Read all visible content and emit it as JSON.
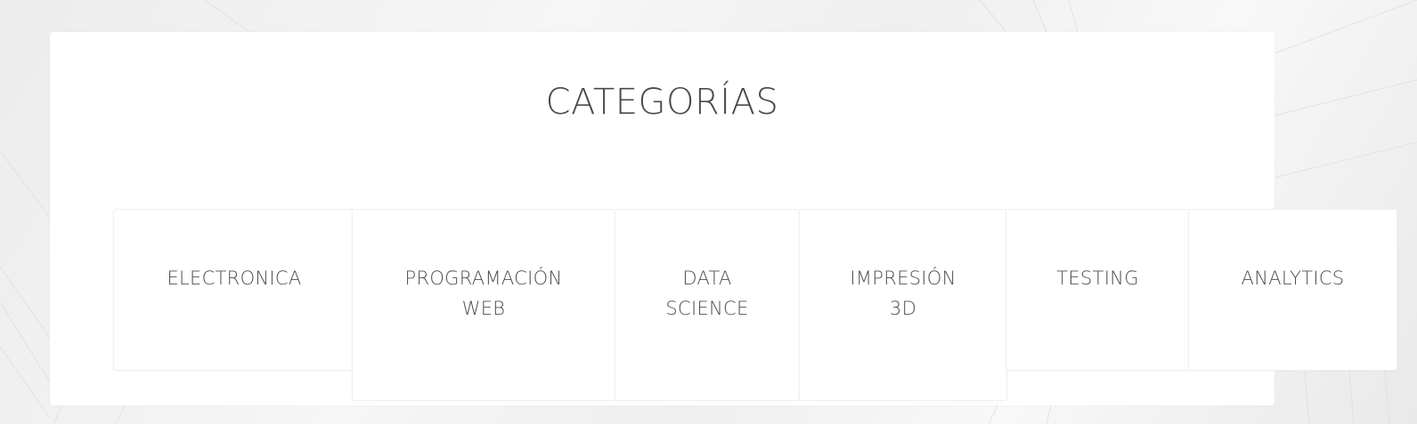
{
  "section": {
    "title": "CATEGORÍAS"
  },
  "categories": [
    {
      "label": "ELECTRONICA"
    },
    {
      "label": "PROGRAMACIÓN\nWEB"
    },
    {
      "label": "DATA\nSCIENCE"
    },
    {
      "label": "IMPRESIÓN\n3D"
    },
    {
      "label": "TESTING"
    },
    {
      "label": "ANALYTICS"
    }
  ],
  "colors": {
    "panel": "#ffffff",
    "text": "#4a4a4a",
    "background": "#f0f0f0"
  }
}
